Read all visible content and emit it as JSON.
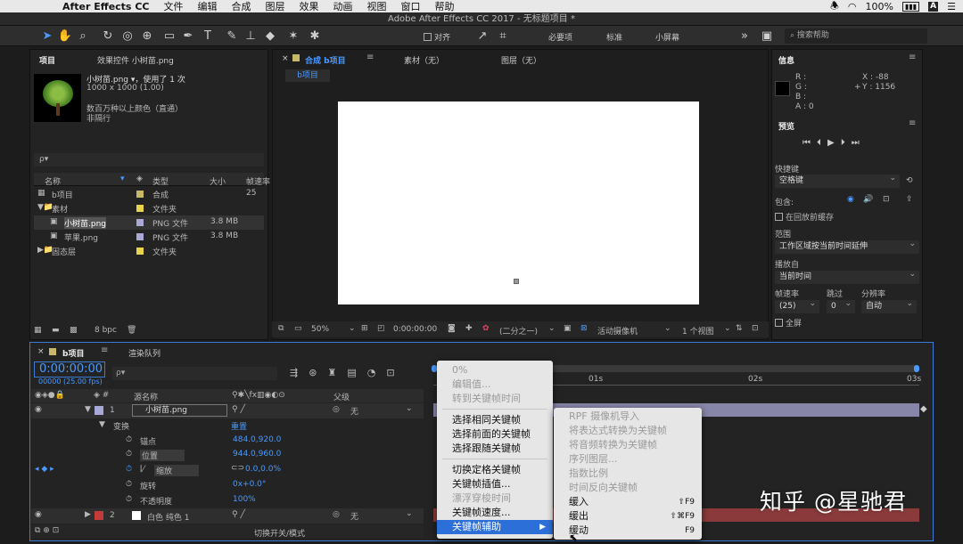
{
  "menubar": {
    "app": "After Effects CC",
    "items": [
      "文件",
      "编辑",
      "合成",
      "图层",
      "效果",
      "动画",
      "视图",
      "窗口",
      "帮助"
    ],
    "battery_pct": "100%",
    "user_initial": "A"
  },
  "window_title": "Adobe After Effects CC 2017 - 无标题项目 *",
  "toolbar": {
    "align_label": "对齐",
    "workspaces": [
      "必要项",
      "标准",
      "小屏幕"
    ],
    "search_label": "搜索帮助"
  },
  "project": {
    "tab_project": "项目",
    "tab_effects": "效果控件 小树苗.png",
    "asset_name": "小树苗.png ▾，使用了 1 次",
    "asset_size": "1000 x 1000 (1.00)",
    "asset_colors": "数百万种以上颜色（直通）",
    "asset_interlace": "非隔行",
    "search_placeholder": "ρ▾",
    "columns": [
      "名称",
      "类型",
      "大小",
      "帧速率"
    ],
    "rows": [
      {
        "name": "b项目",
        "type": "合成",
        "size": "",
        "fps": "25",
        "color": "#c8b86a"
      },
      {
        "name": "素材",
        "type": "文件夹",
        "size": "",
        "fps": "",
        "color": "#e8d44a"
      },
      {
        "name": "小树苗.png",
        "type": "PNG 文件",
        "size": "3.8 MB",
        "fps": "",
        "color": "#a9a9d8"
      },
      {
        "name": "苹果.png",
        "type": "PNG 文件",
        "size": "3.8 MB",
        "fps": "",
        "color": "#a9a9d8"
      },
      {
        "name": "固态层",
        "type": "文件夹",
        "size": "",
        "fps": "",
        "color": "#e8d44a"
      }
    ],
    "bpc": "8 bpc"
  },
  "composition": {
    "tab_comp": "合成 b项目",
    "tab_footage": "素材（无）",
    "tab_layer": "图层（无）",
    "breadcrumb": "b项目",
    "zoom": "50%",
    "timecode": "0:00:00:00",
    "resolution": "(二分之一)",
    "camera": "活动摄像机",
    "views": "1 个视图"
  },
  "info": {
    "title": "信息",
    "r": "R :",
    "g": "G :",
    "b": "B :",
    "a": "A : 0",
    "x": "X : -88",
    "y": "Y : 1156"
  },
  "preview": {
    "title": "预览",
    "shortcut_label": "快捷键",
    "shortcut_value": "空格键",
    "include_label": "包含:",
    "cache_label": "在回放前缓存",
    "range_label": "范围",
    "range_value": "工作区域按当前时间延伸",
    "play_from_label": "播放自",
    "play_from_value": "当前时间",
    "fps_label": "帧速率",
    "skip_label": "跳过",
    "res_label": "分辨率",
    "fps_value": "(25)",
    "skip_value": "0",
    "res_value": "自动",
    "fullscreen_label": "全屏"
  },
  "timeline": {
    "tab_comp": "b项目",
    "tab_render": "渲染队列",
    "timecode": "0:00:00:00",
    "fps_note": "00000 (25.00 fps)",
    "col_name": "源名称",
    "col_parent": "父级",
    "layer1_num": "1",
    "layer1_name": "小树苗.png",
    "parent_value": "无",
    "transform": "变换",
    "reset": "重置",
    "props": [
      {
        "name": "锚点",
        "value": "484.0,920.0"
      },
      {
        "name": "位置",
        "value": "944.0,960.0"
      },
      {
        "name": "缩放",
        "value": "0.0,0.0%"
      },
      {
        "name": "旋转",
        "value": "0x+0.0°"
      },
      {
        "name": "不透明度",
        "value": "100%"
      }
    ],
    "layer2_num": "2",
    "layer2_name": "白色 纯色 1",
    "toggle_label": "切换开关/模式",
    "ruler": [
      "01s",
      "02s",
      "03s"
    ]
  },
  "menu_main": {
    "items": [
      {
        "label": "0%",
        "disabled": true
      },
      {
        "label": "编辑值...",
        "disabled": true
      },
      {
        "label": "转到关键帧时间",
        "disabled": true
      },
      {
        "sep": true
      },
      {
        "label": "选择相同关键帧",
        "disabled": false
      },
      {
        "label": "选择前面的关键帧",
        "disabled": false
      },
      {
        "label": "选择跟随关键帧",
        "disabled": false
      },
      {
        "sep": true
      },
      {
        "label": "切换定格关键帧",
        "disabled": false
      },
      {
        "label": "关键帧插值...",
        "disabled": false
      },
      {
        "label": "漂浮穿梭时间",
        "disabled": true
      },
      {
        "label": "关键帧速度...",
        "disabled": false
      },
      {
        "label": "关键帧辅助",
        "disabled": false,
        "highlight": true,
        "arrow": "▶"
      }
    ]
  },
  "menu_sub": {
    "items": [
      {
        "label": "RPF 摄像机导入",
        "disabled": true,
        "shortcut": ""
      },
      {
        "label": "将表达式转换为关键帧",
        "disabled": true,
        "shortcut": ""
      },
      {
        "label": "将音频转换为关键帧",
        "disabled": true,
        "shortcut": ""
      },
      {
        "label": "序列图层...",
        "disabled": true,
        "shortcut": ""
      },
      {
        "label": "指数比例",
        "disabled": true,
        "shortcut": ""
      },
      {
        "label": "时间反向关键帧",
        "disabled": true,
        "shortcut": ""
      },
      {
        "label": "缓入",
        "disabled": false,
        "shortcut": "⇧F9"
      },
      {
        "label": "缓出",
        "disabled": false,
        "shortcut": "⇧⌘F9"
      },
      {
        "label": "缓动",
        "disabled": false,
        "shortcut": "F9"
      }
    ]
  },
  "watermark": "知乎 @星驰君"
}
